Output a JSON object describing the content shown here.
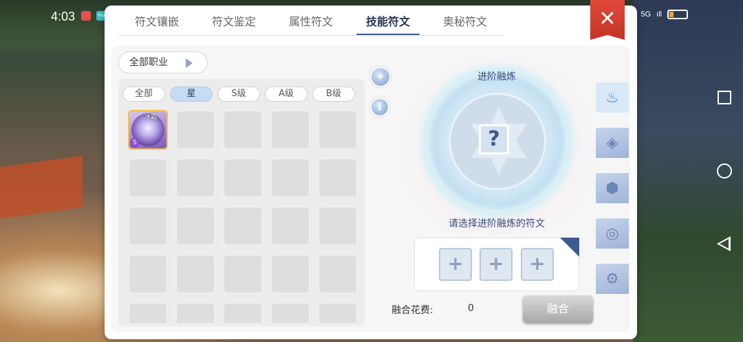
{
  "status_bar": {
    "time": "4:03",
    "app2_label": "Yop",
    "network": "5G",
    "signal": "ıll"
  },
  "tabs": [
    {
      "label": "符文镶嵌",
      "active": false
    },
    {
      "label": "符文鉴定",
      "active": false
    },
    {
      "label": "属性符文",
      "active": false
    },
    {
      "label": "技能符文",
      "active": true
    },
    {
      "label": "奥秘符文",
      "active": false
    }
  ],
  "close_label": "✕",
  "job_filter": {
    "label": "全部职业"
  },
  "grade_filters": [
    {
      "label": "全部",
      "active": false
    },
    {
      "label": "星",
      "active": true
    },
    {
      "label": "S级",
      "active": false
    },
    {
      "label": "A级",
      "active": false
    },
    {
      "label": "B级",
      "active": false
    }
  ],
  "rune_item": {
    "name": "冰霜",
    "grade": "S"
  },
  "tools": {
    "wand_icon": "magic-wand-icon",
    "info_label": "i"
  },
  "fusion": {
    "title": "进阶融炼",
    "placeholder": "?",
    "hint": "请选择进阶融炼的符文",
    "material_slots": [
      "+",
      "+",
      "+"
    ],
    "cost_label": "融合花费:",
    "cost_value": "0",
    "button_label": "融合"
  },
  "side_tabs": [
    {
      "icon": "flame-lotus-icon",
      "active": true
    },
    {
      "icon": "rune-emblem-icon",
      "active": false
    },
    {
      "icon": "shield-emblem-icon",
      "active": false
    },
    {
      "icon": "swirl-emblem-icon",
      "active": false
    },
    {
      "icon": "gear-emblem-icon",
      "active": false
    }
  ],
  "colors": {
    "accent": "#3a5a9a",
    "active_filter": "#c7dcf4",
    "close": "#d43d2e",
    "rune_border": "#f0c24a"
  }
}
